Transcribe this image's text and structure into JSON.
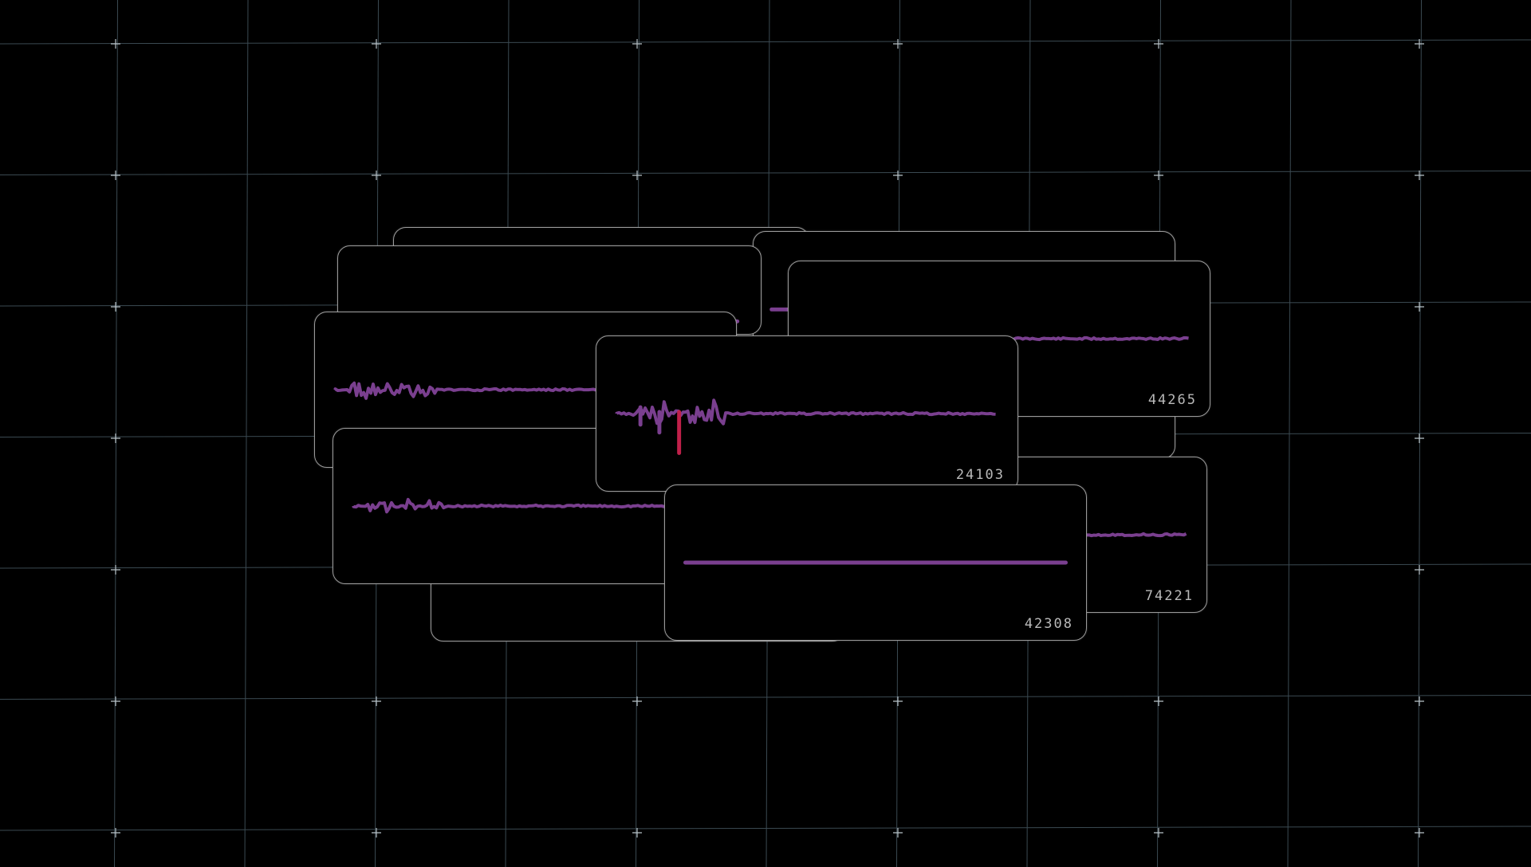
{
  "colors": {
    "background": "#000000",
    "grid_line": "#3b4a52",
    "grid_marker": "#b8c2c8",
    "card_border": "#9a9a9a",
    "waveform": "#7a3f8f",
    "waveform_peak": "#c0204a",
    "label": "#b9b9b9"
  },
  "icons": {
    "grid_marker": "plus-marker-icon"
  },
  "cards": [
    {
      "id": "bg-card-a",
      "label": ""
    },
    {
      "id": "bg-card-b",
      "label": ""
    },
    {
      "id": "bg-card-c",
      "label": ""
    },
    {
      "id": "card-44265",
      "label": "44265"
    },
    {
      "id": "card-left",
      "label": ""
    },
    {
      "id": "card-under",
      "label": ""
    },
    {
      "id": "card-74221",
      "label": "74221"
    },
    {
      "id": "card-lower-left",
      "label": ""
    },
    {
      "id": "card-24103",
      "label": "24103"
    },
    {
      "id": "card-42308",
      "label": "42308"
    }
  ]
}
